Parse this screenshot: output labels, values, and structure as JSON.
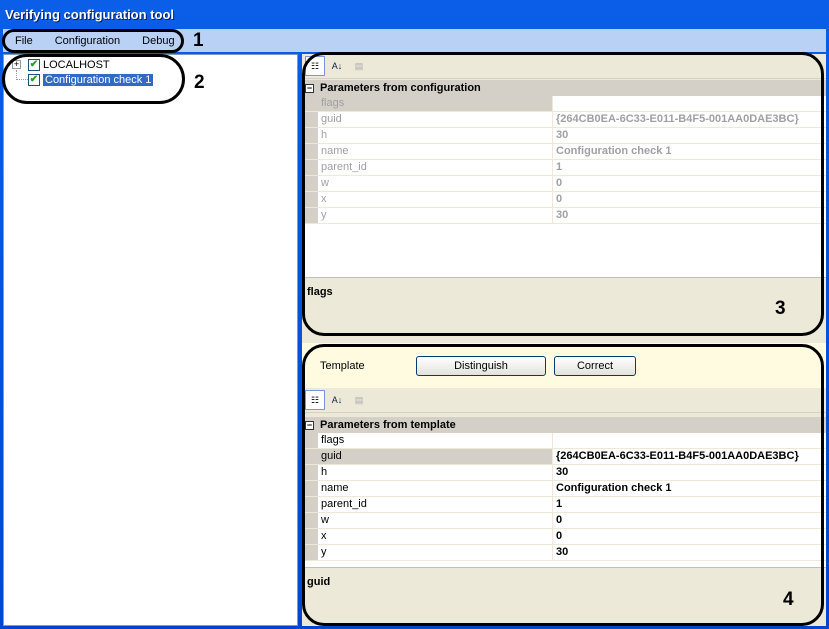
{
  "window": {
    "title": "Verifying configuration tool"
  },
  "menu": [
    "File",
    "Configuration",
    "Debug"
  ],
  "tree": {
    "root": "LOCALHOST",
    "child": "Configuration check 1"
  },
  "config": {
    "category": "Parameters from configuration",
    "rows": [
      [
        "flags",
        ""
      ],
      [
        "guid",
        "{264CB0EA-6C33-E011-B4F5-001AA0DAE3BC}"
      ],
      [
        "h",
        "30"
      ],
      [
        "name",
        "Configuration check 1"
      ],
      [
        "parent_id",
        "1"
      ],
      [
        "w",
        "0"
      ],
      [
        "x",
        "0"
      ],
      [
        "y",
        "30"
      ]
    ],
    "description": "flags"
  },
  "template": {
    "label": "Template",
    "distinguish": "Distinguish",
    "correct": "Correct",
    "category": "Parameters from template",
    "rows": [
      [
        "flags",
        ""
      ],
      [
        "guid",
        "{264CB0EA-6C33-E011-B4F5-001AA0DAE3BC}"
      ],
      [
        "h",
        "30"
      ],
      [
        "name",
        "Configuration check 1"
      ],
      [
        "parent_id",
        "1"
      ],
      [
        "w",
        "0"
      ],
      [
        "x",
        "0"
      ],
      [
        "y",
        "30"
      ]
    ],
    "description": "guid"
  },
  "annotations": [
    "1",
    "2",
    "3",
    "4"
  ]
}
